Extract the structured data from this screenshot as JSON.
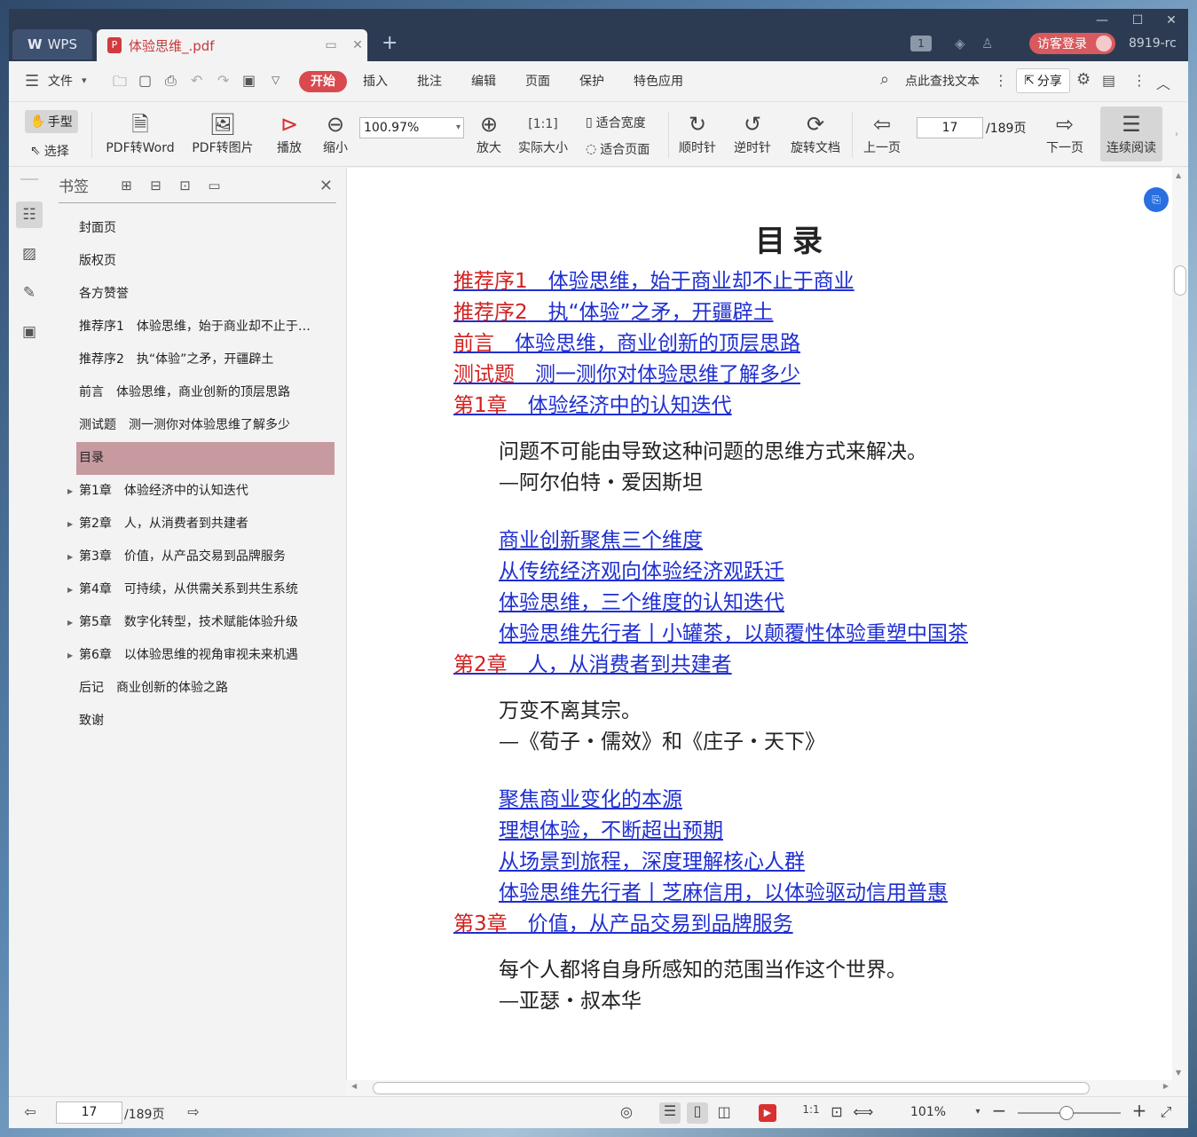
{
  "titlebar": {
    "app_tab": "WPS",
    "doc_tab": "体验思维_.pdf",
    "badge": "1",
    "login": "访客登录",
    "version": "8919-rc"
  },
  "menubar": {
    "file": "文件",
    "start": "开始",
    "items": [
      "插入",
      "批注",
      "编辑",
      "页面",
      "保护",
      "特色应用"
    ],
    "search": "点此查找文本",
    "share": "分享"
  },
  "toolbar": {
    "hand": "手型",
    "select": "选择",
    "pdf_word": "PDF转Word",
    "pdf_image": "PDF转图片",
    "play": "播放",
    "zoom_out": "缩小",
    "zoom_value": "100.97%",
    "zoom_in": "放大",
    "actual_size": "实际大小",
    "fit_width": "适合宽度",
    "fit_page": "适合页面",
    "clockwise": "顺时针",
    "counter_clockwise": "逆时针",
    "rotate_doc": "旋转文档",
    "prev_page": "上一页",
    "page_current": "17",
    "page_total": "/189页",
    "next_page": "下一页",
    "continuous": "连续阅读"
  },
  "panel": {
    "title": "书签",
    "bookmarks": [
      {
        "label": "封面页",
        "expandable": false,
        "active": false
      },
      {
        "label": "版权页",
        "expandable": false,
        "active": false
      },
      {
        "label": "各方赞誉",
        "expandable": false,
        "active": false
      },
      {
        "label": "推荐序1　体验思维，始于商业却不止于…",
        "expandable": false,
        "active": false
      },
      {
        "label": "推荐序2　执“体验”之矛，开疆辟土",
        "expandable": false,
        "active": false
      },
      {
        "label": "前言　体验思维，商业创新的顶层思路",
        "expandable": false,
        "active": false
      },
      {
        "label": "测试题　测一测你对体验思维了解多少",
        "expandable": false,
        "active": false
      },
      {
        "label": "目录",
        "expandable": false,
        "active": true
      },
      {
        "label": "第1章　体验经济中的认知迭代",
        "expandable": true,
        "active": false
      },
      {
        "label": "第2章　人，从消费者到共建者",
        "expandable": true,
        "active": false
      },
      {
        "label": "第3章　价值，从产品交易到品牌服务",
        "expandable": true,
        "active": false
      },
      {
        "label": "第4章　可持续，从供需关系到共生系统",
        "expandable": true,
        "active": false
      },
      {
        "label": "第5章　数字化转型，技术赋能体验升级",
        "expandable": true,
        "active": false
      },
      {
        "label": "第6章　以体验思维的视角审视未来机遇",
        "expandable": true,
        "active": false
      },
      {
        "label": "后记　商业创新的体验之路",
        "expandable": false,
        "active": false
      },
      {
        "label": "致谢",
        "expandable": false,
        "active": false
      }
    ]
  },
  "document": {
    "title": "目录",
    "front": [
      {
        "label": "推荐序1",
        "text": "　体验思维，始于商业却不止于商业"
      },
      {
        "label": "推荐序2",
        "text": "　执“体验”之矛，开疆辟土"
      },
      {
        "label": "前言",
        "text": "　体验思维，商业创新的顶层思路"
      },
      {
        "label": "测试题",
        "text": "　测一测你对体验思维了解多少"
      }
    ],
    "chapters": [
      {
        "label": "第1章",
        "text": "　体验经济中的认知迭代",
        "quote": [
          "问题不可能由导致这种问题的思维方式来解决。",
          "—阿尔伯特・爱因斯坦"
        ],
        "sections": [
          "商业创新聚焦三个维度",
          "从传统经济观向体验经济观跃迁",
          "体验思维，三个维度的认知迭代",
          "体验思维先行者丨小罐茶，以颠覆性体验重塑中国茶"
        ]
      },
      {
        "label": "第2章",
        "text": "　人，从消费者到共建者",
        "quote": [
          "万变不离其宗。",
          "—《荀子・儒效》和《庄子・天下》"
        ],
        "sections": [
          "聚焦商业变化的本源",
          "理想体验，不断超出预期",
          "从场景到旅程，深度理解核心人群",
          "体验思维先行者丨芝麻信用，以体验驱动信用普惠"
        ]
      },
      {
        "label": "第3章",
        "text": "　价值，从产品交易到品牌服务",
        "quote": [
          "每个人都将自身所感知的范围当作这个世界。",
          "—亚瑟・叔本华"
        ],
        "sections": []
      }
    ]
  },
  "statusbar": {
    "page_current": "17",
    "page_total": "/189页",
    "zoom": "101%"
  },
  "colors": {
    "titlebar": "#2c3b52",
    "accent_red": "#d94a4e",
    "link_blue": "#1f2fd1",
    "label_red": "#d22020",
    "active_bookmark": "#c79aa0"
  }
}
